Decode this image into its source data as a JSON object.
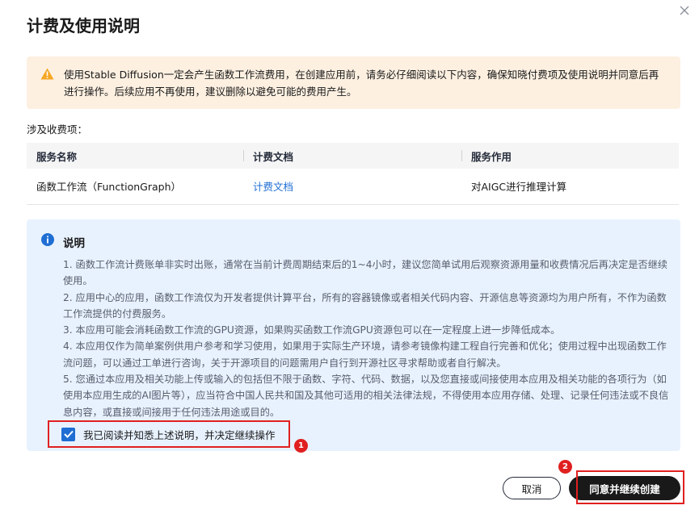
{
  "dialog": {
    "title": "计费及使用说明"
  },
  "warning": {
    "icon": "warning-icon",
    "color": "#f5a623",
    "text": "使用Stable Diffusion一定会产生函数工作流费用，在创建应用前，请务必仔细阅读以下内容，确保知晓付费项及使用说明并同意后再进行操作。后续应用不再使用，建议删除以避免可能的费用产生。"
  },
  "fees": {
    "label": "涉及收费项：",
    "columns": [
      "服务名称",
      "计费文档",
      "服务作用"
    ],
    "rows": [
      {
        "service": "函数工作流（FunctionGraph）",
        "doc_link": "计费文档",
        "purpose": "对AIGC进行推理计算"
      }
    ]
  },
  "notes": {
    "icon": "info-icon",
    "title": "说明",
    "items": [
      "1. 函数工作流计费账单非实时出账，通常在当前计费周期结束后的1~4小时，建议您简单试用后观察资源用量和收费情况后再决定是否继续使用。",
      "2. 应用中心的应用，函数工作流仅为开发者提供计算平台，所有的容器镜像或者相关代码内容、开源信息等资源均为用户所有，不作为函数工作流提供的付费服务。",
      "3. 本应用可能会消耗函数工作流的GPU资源，如果购买函数工作流GPU资源包可以在一定程度上进一步降低成本。",
      "4. 本应用仅作为简单案例供用户参考和学习使用，如果用于实际生产环境，请参考镜像构建工程自行完善和优化；使用过程中出现函数工作流问题，可以通过工单进行咨询，关于开源项目的问题需用户自行到开源社区寻求帮助或者自行解决。",
      "5. 您通过本应用及相关功能上传或输入的包括但不限于函数、字符、代码、数据，以及您直接或间接使用本应用及相关功能的各项行为（如使用本应用生成的AI图片等），应当符合中国人民共和国及其他可适用的相关法律法规，不得使用本应用存储、处理、记录任何违法或不良信息内容，或直接或间接用于任何违法用途或目的。"
    ],
    "agree_label": "我已阅读并知悉上述说明，并决定继续操作",
    "agree_checked": true
  },
  "annotations": {
    "step1": "1",
    "step2": "2",
    "color": "#e02020"
  },
  "footer": {
    "cancel_label": "取消",
    "confirm_label": "同意并继续创建"
  }
}
